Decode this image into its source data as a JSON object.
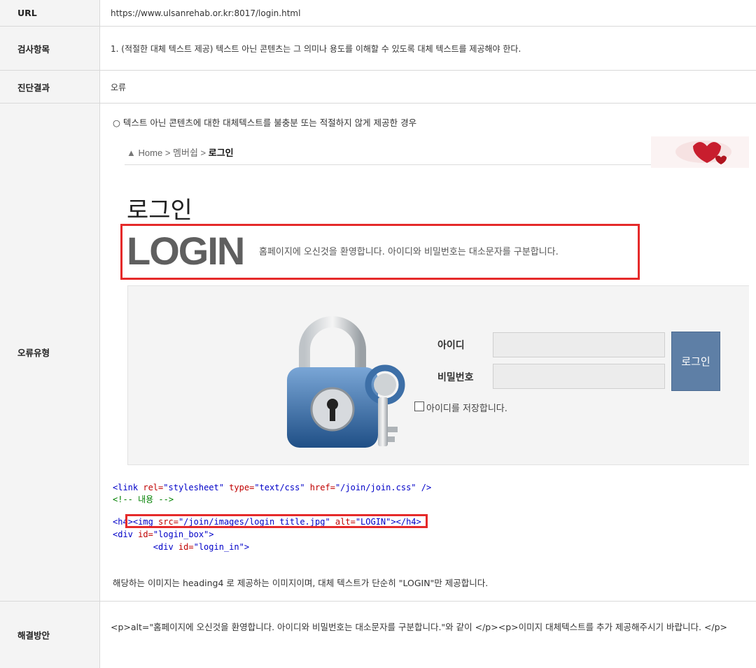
{
  "rows": {
    "url": {
      "header": "URL",
      "value": "https://www.ulsanrehab.or.kr:8017/login.html"
    },
    "check_item": {
      "header": "검사항목",
      "value": "1. (적절한 대체 텍스트 제공) 텍스트 아닌 콘텐츠는 그 의미나 용도를 이해할 수 있도록 대체 텍스트를 제공해야 한다."
    },
    "result": {
      "header": "진단결과",
      "value": "오류"
    },
    "error_type": {
      "header": "오류유형",
      "intro": "○ 텍스트 아닌 콘텐츠에 대한 대체텍스트를 불충분 또는 적절하지 않게 제공한 경우"
    },
    "solution": {
      "header": "해결방안",
      "value": "<p>alt=\"홈페이지에 오신것을 환영합니다. 아이디와 비밀번호는 대소문자를 구분합니다.\"와 같이 </p><p>이미지 대체텍스트를 추가 제공해주시기 바랍니다. </p>"
    }
  },
  "screenshot": {
    "breadcrumb": {
      "home": "Home",
      "sep": ">",
      "level1": "멤버쉽",
      "current": "로그인"
    },
    "page_title": "로그인",
    "login_heading": "LOGIN",
    "welcome_text": "홈페이지에 오신것을 환영합니다. 아이디와 비밀번호는 대소문자를 구분합니다.",
    "id_label": "아이디",
    "pw_label": "비밀번호",
    "login_button": "로그인",
    "save_id_label": "아이디를 저장합니다.",
    "icons": [
      "home-icon",
      "padlock-key-illustration",
      "heart-decoration"
    ]
  },
  "code": {
    "line1": {
      "open": "<link ",
      "a1": "rel=",
      "v1": "\"stylesheet\"",
      "a2": " type=",
      "v2": "\"text/css\"",
      "a3": " href=",
      "v3": "\"/join/join.css\"",
      "close": " />"
    },
    "line2": "<!-- 내용 -->",
    "line3": {
      "h4open": "<h4>",
      "imgopen": "<img ",
      "a1": "src=",
      "v1": "\"/join/images/login_title.jpg\"",
      "a2": " alt=",
      "v2": "\"LOGIN\"",
      "imgclose": ">",
      "h4close": "</h4>"
    },
    "line4": {
      "open": "<div ",
      "a1": "id=",
      "v1": "\"login_box\"",
      "close": ">"
    },
    "line5": {
      "indent": "        ",
      "open": "<div ",
      "a1": "id=",
      "v1": "\"login_in\"",
      "close": ">"
    }
  },
  "explanation": "해당하는 이미지는 heading4 로 제공하는 이미지이며, 대체 텍스트가 단순히 \"LOGIN\"만 제공합니다.",
  "colors": {
    "highlight": "#e52a2a",
    "button": "#5e7fa6",
    "header_bg": "#f4f4f4"
  }
}
